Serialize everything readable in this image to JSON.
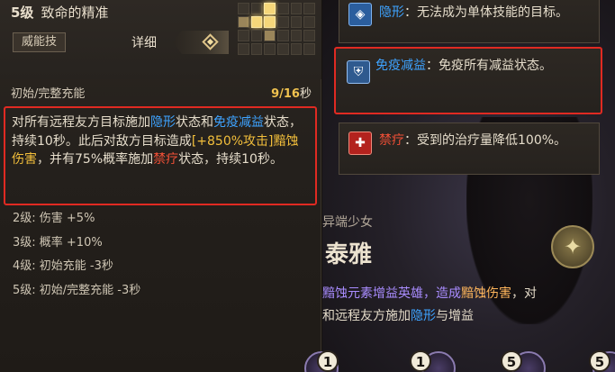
{
  "skill": {
    "level": "5级",
    "name": "致命的精准",
    "tag": "威能技",
    "detail_label": "详细",
    "energy_label": "初始/完整充能",
    "energy_value": "9/16",
    "energy_unit": "秒"
  },
  "description": {
    "p1": "对所有远程友方目标施加",
    "k_stealth": "隐形",
    "p2": "状态和",
    "k_immune": "免疫减益",
    "p3": "状态，持续10秒。此后对敌方目标造成",
    "k_damage": "[+850%攻击]黯蚀伤害",
    "p4": "，并有75%概率施加",
    "k_heal_block": "禁疗",
    "p5": "状态，持续10秒。"
  },
  "level_upgrades": [
    "2级:  伤害 +5%",
    "3级:  概率 +10%",
    "4级:  初始充能 -3秒",
    "5级:  初始/完整充能 -3秒"
  ],
  "status_effects": {
    "stealth": {
      "name": "隐形",
      "text": "：无法成为单体技能的目标。"
    },
    "immune": {
      "name": "免疫减益",
      "text": "：免疫所有减益状态。"
    },
    "heal_block": {
      "name": "禁疗",
      "text": "：受到的治疗量降低100%。"
    }
  },
  "hero": {
    "subtitle": "异端少女",
    "name": "泰雅",
    "desc_a": "黯蚀元素增益英雄，造成",
    "desc_b": "黯蚀伤害",
    "desc_c": "，对",
    "desc_d": "和远程友方施加",
    "desc_e": "隐形",
    "desc_f": "与增益"
  },
  "bottom_numbers": [
    "1",
    "1",
    "5",
    "5"
  ],
  "colors": {
    "highlight_blue": "#3ea3ff",
    "highlight_red": "#ef4f36",
    "highlight_gold": "#f3bf3b",
    "annotation_red": "#e02a22"
  },
  "icons": [
    "grid-icon",
    "diamond-toggle-icon",
    "shield-icon",
    "cross-icon",
    "hero-emblem-icon"
  ]
}
